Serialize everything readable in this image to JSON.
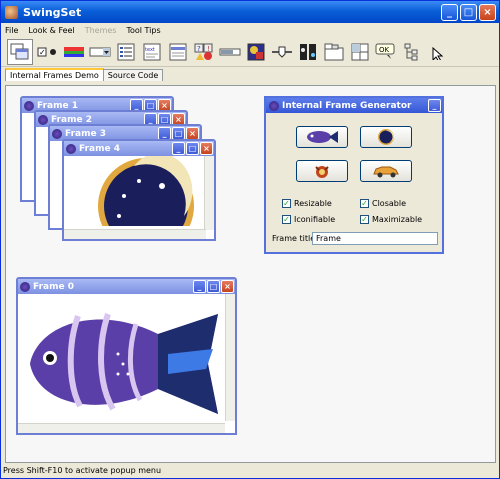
{
  "window": {
    "title": "SwingSet"
  },
  "menus": [
    {
      "label": "File",
      "disabled": false
    },
    {
      "label": "Look & Feel",
      "disabled": false
    },
    {
      "label": "Themes",
      "disabled": true
    },
    {
      "label": "Tool Tips",
      "disabled": false
    }
  ],
  "tabs": [
    "Internal Frames Demo",
    "Source Code"
  ],
  "frames": [
    "Frame 1",
    "Frame 2",
    "Frame 3",
    "Frame 4",
    "Frame 0"
  ],
  "generator": {
    "title": "Internal Frame Generator",
    "options": [
      {
        "label": "Resizable",
        "checked": true
      },
      {
        "label": "Closable",
        "checked": true
      },
      {
        "label": "Iconifiable",
        "checked": true
      },
      {
        "label": "Maximizable",
        "checked": true
      }
    ],
    "frame_title_label": "Frame title:",
    "frame_title_value": "Frame"
  },
  "status": "Press Shift-F10 to activate popup menu"
}
